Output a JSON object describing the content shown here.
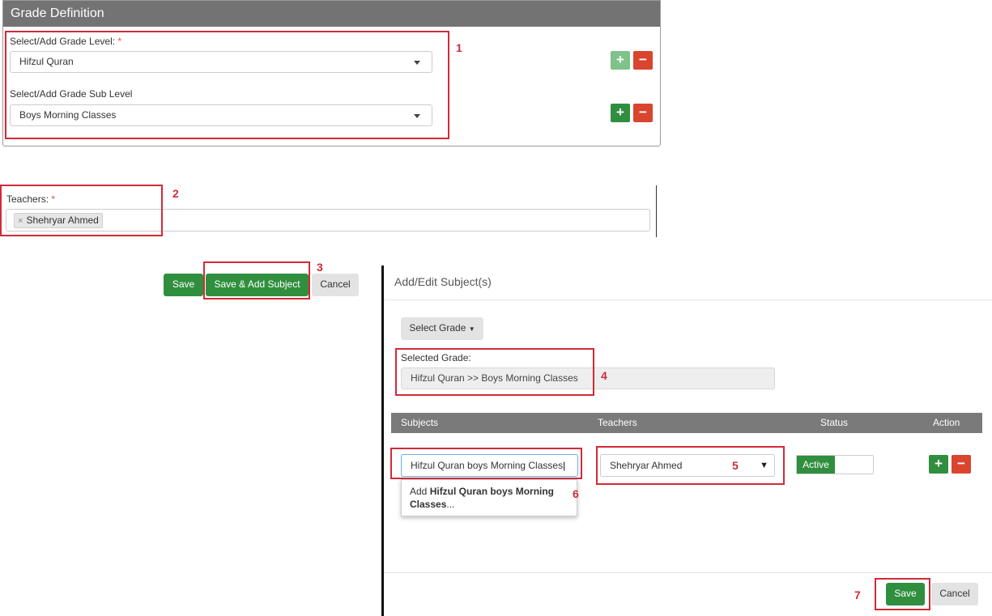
{
  "grade_definition": {
    "title": "Grade Definition",
    "grade_level": {
      "label": "Select/Add Grade Level:",
      "required": "*",
      "value": "Hifzul Quran"
    },
    "grade_sub_level": {
      "label": "Select/Add Grade Sub Level",
      "value": "Boys Morning Classes"
    },
    "add_label": "+",
    "remove_label": "−"
  },
  "teachers": {
    "label": "Teachers:",
    "required": "*",
    "tags": [
      {
        "remove": "×",
        "name": "Shehryar Ahmed"
      }
    ]
  },
  "actions": {
    "save": "Save",
    "save_add_subject": "Save & Add Subject",
    "cancel": "Cancel"
  },
  "modal": {
    "title": "Add/Edit Subject(s)",
    "select_grade_button": "Select Grade",
    "selected_grade": {
      "label": "Selected Grade:",
      "value": "Hifzul Quran >> Boys Morning Classes"
    },
    "table": {
      "headers": [
        "Subjects",
        "Teachers",
        "Status",
        "Action"
      ],
      "row": {
        "subject_input": "Hifzul Quran boys Morning Classes",
        "teacher": "Shehryar Ahmed",
        "status": "Active",
        "add_label": "+",
        "remove_label": "−"
      },
      "suggestion": {
        "prefix": "Add ",
        "bold": "Hifzul Quran boys Morning",
        "bold2": "Classes",
        "suffix": "..."
      }
    },
    "footer": {
      "save": "Save",
      "cancel": "Cancel"
    }
  },
  "annotations": [
    "1",
    "2",
    "3",
    "4",
    "5",
    "6",
    "7"
  ],
  "colors": {
    "accent_green": "#2f8f3e",
    "danger_red": "#d9452e",
    "annotation_red": "#d22a38",
    "header_gray": "#737373"
  }
}
